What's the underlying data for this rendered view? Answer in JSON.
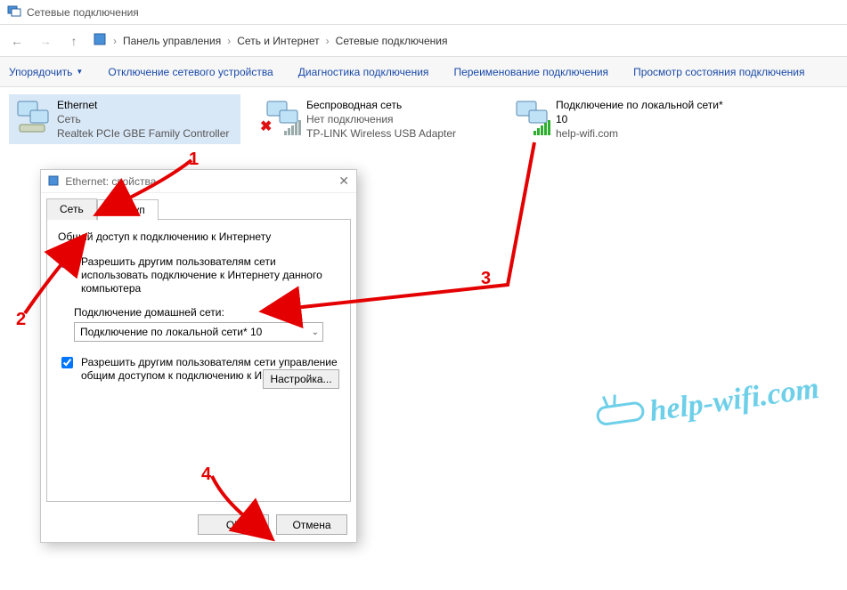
{
  "window": {
    "title": "Сетевые подключения"
  },
  "breadcrumb": {
    "item1": "Панель управления",
    "item2": "Сеть и Интернет",
    "item3": "Сетевые подключения"
  },
  "toolbar": {
    "organize": "Упорядочить",
    "disable": "Отключение сетевого устройства",
    "diagnose": "Диагностика подключения",
    "rename": "Переименование подключения",
    "status": "Просмотр состояния подключения"
  },
  "connections": {
    "ethernet": {
      "name": "Ethernet",
      "status": "Сеть",
      "device": "Realtek PCIe GBE Family Controller"
    },
    "wifi": {
      "name": "Беспроводная сеть",
      "status": "Нет подключения",
      "device": "TP-LINK Wireless USB Adapter"
    },
    "local": {
      "name": "Подключение по локальной сети* 10",
      "status": "help-wifi.com",
      "device": ""
    }
  },
  "dialog": {
    "title": "Ethernet: свойства",
    "tab_network": "Сеть",
    "tab_access": "Доступ",
    "group_label": "Общий доступ к подключению к Интернету",
    "chk1": "Разрешить другим пользователям сети использовать подключение к Интернету данного компьютера",
    "home_net_label": "Подключение домашней сети:",
    "home_net_value": "Подключение по локальной сети* 10",
    "chk2": "Разрешить другим пользователям сети управление общим доступом к подключению к Интернету",
    "settings_btn": "Настройка...",
    "ok": "ОК",
    "cancel": "Отмена"
  },
  "annotations": {
    "n1": "1",
    "n2": "2",
    "n3": "3",
    "n4": "4"
  },
  "watermark": "help-wifi.com"
}
